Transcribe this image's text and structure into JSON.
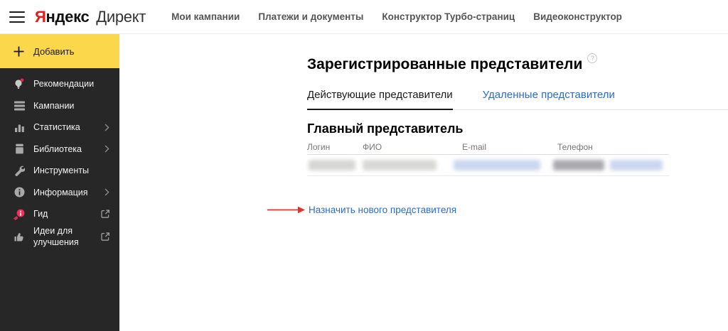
{
  "header": {
    "logo": {
      "brand_accent": "Я",
      "brand_rest": "ндекс",
      "product": "Директ"
    },
    "nav": [
      {
        "label": "Мои кампании"
      },
      {
        "label": "Платежи и документы"
      },
      {
        "label": "Конструктор Турбо-страниц"
      },
      {
        "label": "Видеоконструктор"
      }
    ]
  },
  "sidebar": {
    "add_button_label": "Добавить",
    "items": [
      {
        "label": "Рекомендации",
        "icon": "lightbulb-notification-icon",
        "chevron": false,
        "external": false
      },
      {
        "label": "Кампании",
        "icon": "campaigns-list-icon",
        "chevron": false,
        "external": false
      },
      {
        "label": "Статистика",
        "icon": "bar-chart-icon",
        "chevron": true,
        "external": false
      },
      {
        "label": "Библиотека",
        "icon": "library-icon",
        "chevron": true,
        "external": false
      },
      {
        "label": "Инструменты",
        "icon": "wrench-icon",
        "chevron": false,
        "external": false
      },
      {
        "label": "Информация",
        "icon": "info-circle-icon",
        "chevron": true,
        "external": false
      },
      {
        "label": "Гид",
        "icon": "guide-comet-icon",
        "chevron": false,
        "external": true
      },
      {
        "label": "Идеи для улучшения",
        "icon": "thumbs-up-icon",
        "chevron": false,
        "external": true
      }
    ],
    "colors": {
      "background": "#272727",
      "add_button_yellow": "#fbd74c"
    }
  },
  "main": {
    "page_title": "Зарегистрированные представители",
    "help_icon": "help-circle-icon",
    "tabs": [
      {
        "label": "Действующие представители",
        "active": true
      },
      {
        "label": "Удаленные представители",
        "active": false
      }
    ],
    "section_title": "Главный представитель",
    "table": {
      "columns": [
        "Логин",
        "ФИО",
        "E-mail",
        "Телефон"
      ],
      "rows_redacted": true
    },
    "assign_link_label": "Назначить нового представителя",
    "colors": {
      "link_blue": "#2b6cc9",
      "arrow_red": "#e53030"
    }
  }
}
